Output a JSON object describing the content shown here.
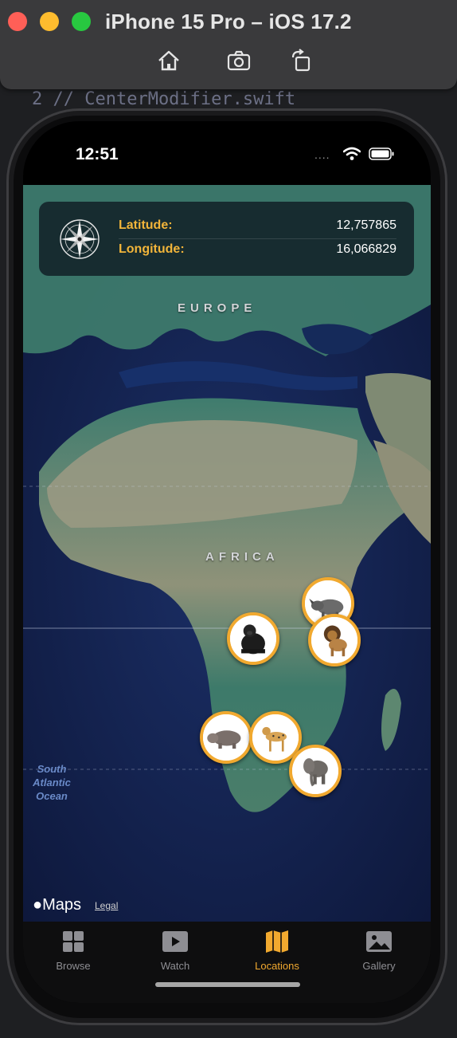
{
  "simulator": {
    "title": "iPhone 15 Pro – iOS 17.2",
    "tools": [
      "home-icon",
      "screenshot-icon",
      "rotate-icon"
    ]
  },
  "editor": {
    "line_text": "2  //  CenterModifier.swift"
  },
  "status_bar": {
    "time": "12:51",
    "dots": "....",
    "icons": [
      "wifi-icon",
      "battery-icon"
    ]
  },
  "coordinates": {
    "latitude_label": "Latitude:",
    "latitude_value": "12,757865",
    "longitude_label": "Longitude:",
    "longitude_value": "16,066829",
    "accent_color": "#f2b53a"
  },
  "map": {
    "labels": {
      "europe": "EUROPE",
      "africa": "AFRICA",
      "ocean_line1": "South",
      "ocean_line2": "Atlantic",
      "ocean_line3": "Ocean"
    },
    "pins": [
      "rhino",
      "gorilla",
      "lion",
      "hippo",
      "cheetah",
      "elephant"
    ],
    "attribution": "Maps",
    "legal": "Legal"
  },
  "tabbar": {
    "items": [
      {
        "label": "Browse",
        "icon": "grid-icon",
        "active": false
      },
      {
        "label": "Watch",
        "icon": "play-icon",
        "active": false
      },
      {
        "label": "Locations",
        "icon": "map-icon",
        "active": true
      },
      {
        "label": "Gallery",
        "icon": "photo-icon",
        "active": false
      }
    ],
    "active_color": "#f1a92f"
  }
}
